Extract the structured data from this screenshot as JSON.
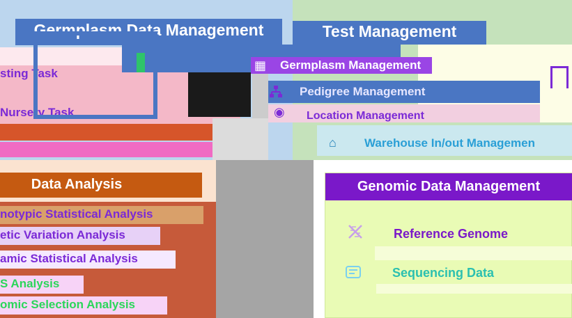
{
  "germplasm": {
    "title": "Germplasm Data Management",
    "items": [
      "sting Task",
      "Nursery Task"
    ]
  },
  "test": {
    "title": "Test Management"
  },
  "menu": {
    "items": [
      {
        "label": "Germplasm Management",
        "icon": "germ-grid-icon"
      },
      {
        "label": "Pedigree Management",
        "icon": "pedigree-tree-icon"
      },
      {
        "label": "Location Management",
        "icon": "location-pin-icon"
      },
      {
        "label": "Warehouse In/out Managemen",
        "icon": "warehouse-icon"
      }
    ]
  },
  "data_analysis": {
    "title": "Data Analysis",
    "items": [
      {
        "label": "notypic Statistical Analysis",
        "color": "#7b2ad6"
      },
      {
        "label": "etic Variation Analysis",
        "color": "#7b2ad6"
      },
      {
        "label": "amic Statistical Analysis",
        "color": "#7b2ad6"
      },
      {
        "label": "S Analysis",
        "color": "#2bd65a"
      },
      {
        "label": "omic Selection Analysis",
        "color": "#2bd65a"
      }
    ]
  },
  "genomic": {
    "title": "Genomic Data Management",
    "items": [
      {
        "label": "Reference Genome",
        "icon": "dna-icon"
      },
      {
        "label": "Sequencing Data",
        "icon": "sequencing-icon"
      }
    ]
  },
  "colors": {
    "germ_accent": "#4a76c3",
    "test_bg": "#c5e2bb",
    "analysis_accent": "#c55a11",
    "genomic_accent": "#7a18c9"
  }
}
